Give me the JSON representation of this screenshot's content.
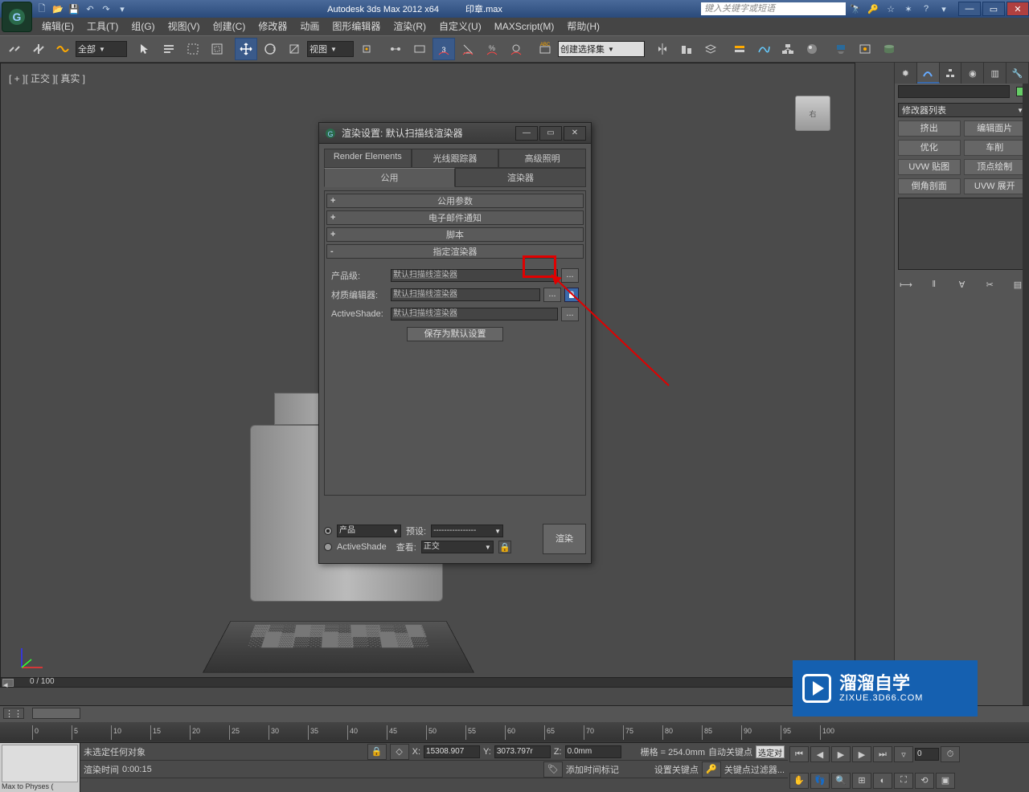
{
  "title": {
    "app": "Autodesk 3ds Max  2012 x64",
    "file": "印章.max",
    "search_placeholder": "键入关键字或短语"
  },
  "menu": {
    "items": [
      "编辑(E)",
      "工具(T)",
      "组(G)",
      "视图(V)",
      "创建(C)",
      "修改器",
      "动画",
      "图形编辑器",
      "渲染(R)",
      "自定义(U)",
      "MAXScript(M)",
      "帮助(H)"
    ]
  },
  "toolbar": {
    "filter": "全部",
    "view": "视图",
    "named_sel": "创建选择集"
  },
  "viewport": {
    "label": "[ + ][ 正交 ][ 真实 ]",
    "cube_face": "右",
    "scroll_label": "0 / 100"
  },
  "command_panel": {
    "modifier_list": "修改器列表",
    "buttons": [
      [
        "挤出",
        "编辑面片"
      ],
      [
        "优化",
        "车削"
      ],
      [
        "UVW 贴图",
        "顶点绘制"
      ],
      [
        "倒角剖面",
        "UVW 展开"
      ]
    ]
  },
  "render_dialog": {
    "title": "渲染设置: 默认扫描线渲染器",
    "tabs_row1": [
      "Render Elements",
      "光线跟踪器",
      "高级照明"
    ],
    "tabs_row2": [
      "公用",
      "渲染器"
    ],
    "rollouts": {
      "common_params": "公用参数",
      "email": "电子邮件通知",
      "script": "脚本",
      "assign": "指定渲染器"
    },
    "assign": {
      "production_label": "产品级:",
      "material_label": "材质编辑器:",
      "activeshade_label": "ActiveShade:",
      "production_value": "默认扫描线渲染器",
      "material_value": "默认扫描线渲染器",
      "activeshade_value": "默认扫描线渲染器",
      "browse": "...",
      "save_default": "保存为默认设置"
    },
    "footer": {
      "product": "产品",
      "activeshade": "ActiveShade",
      "preset_label": "预设:",
      "preset_value": "----------------",
      "view_label": "查看:",
      "view_value": "正交",
      "render": "渲染"
    }
  },
  "timeline": {
    "ticks": [
      0,
      5,
      10,
      15,
      20,
      25,
      30,
      35,
      40,
      45,
      50,
      55,
      60,
      65,
      70,
      75,
      80,
      85,
      90,
      95,
      100
    ]
  },
  "status": {
    "script_hint": "Max to Physes (",
    "selection": "未选定任何对象",
    "render_time_label": "渲染时间",
    "render_time": "0:00:15",
    "x_label": "X:",
    "x": "15308.907",
    "y_label": "Y:",
    "y": "3073.797r",
    "z_label": "Z:",
    "z": "0.0mm",
    "grid": "栅格 = 254.0mm",
    "add_time_tag": "添加时间标记",
    "autokey": "自动关键点",
    "selected": "选定对",
    "set_key": "设置关键点",
    "key_filter": "关键点过滤器...",
    "frame": "0"
  },
  "watermark": {
    "text": "溜溜自学",
    "url": "ZIXUE.3D66.COM"
  }
}
